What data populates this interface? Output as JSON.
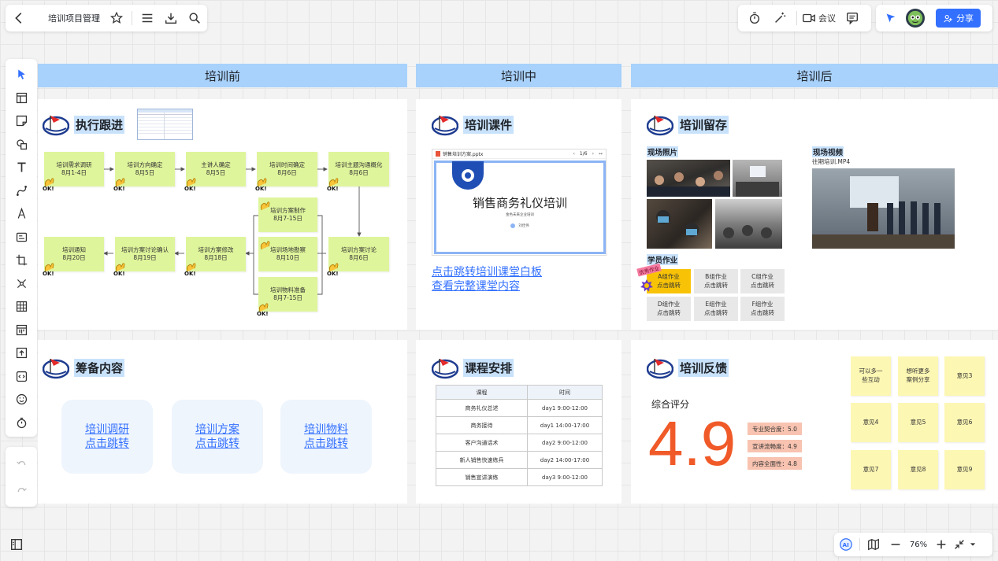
{
  "header": {
    "doc_title": "培训项目管理",
    "meeting_label": "会议",
    "share_label": "分享"
  },
  "zoom": {
    "level": "76%"
  },
  "sections": {
    "before": "培训前",
    "during": "培训中",
    "after": "培训后"
  },
  "execution": {
    "title": "执行跟进",
    "notes": [
      {
        "line1": "培训需求调研",
        "line2": "8月1-4日"
      },
      {
        "line1": "培训方向确定",
        "line2": "8月5日"
      },
      {
        "line1": "主讲人确定",
        "line2": "8月5日"
      },
      {
        "line1": "培训时间确定",
        "line2": "8月6日"
      },
      {
        "line1": "培训主题沟通概化",
        "line2": "8月6日"
      },
      {
        "line1": "培训方案制作",
        "line2": "8月7-15日"
      },
      {
        "line1": "培训场地勘察",
        "line2": "8月10日"
      },
      {
        "line1": "培训物料准备",
        "line2": "8月7-15日"
      },
      {
        "line1": "培训方案讨论",
        "line2": "8月6日"
      },
      {
        "line1": "培训方案修改",
        "line2": "8月18日"
      },
      {
        "line1": "培训方案讨论确认",
        "line2": "8月19日"
      },
      {
        "line1": "培训通知",
        "line2": "8月20日"
      }
    ]
  },
  "courseware": {
    "title": "培训课件",
    "file_name": "销售培训方案.pptx",
    "page": "1/6",
    "slide_title": "销售商务礼仪培训",
    "slide_sub": "金色未来企业培训",
    "slide_author": "刘佳伟",
    "link1": "点击跳转培训课堂白板",
    "link2": "查看完整课堂内容"
  },
  "retention": {
    "title": "培训留存",
    "photos_label": "现场照片",
    "video_label": "现场视频",
    "video_file": "往期培训.MP4",
    "homework_label": "学员作业",
    "excellent_tag": "优秀作业",
    "groups": [
      {
        "name": "A组作业",
        "action": "点击跳转"
      },
      {
        "name": "B组作业",
        "action": "点击跳转"
      },
      {
        "name": "C组作业",
        "action": "点击跳转"
      },
      {
        "name": "D组作业",
        "action": "点击跳转"
      },
      {
        "name": "E组作业",
        "action": "点击跳转"
      },
      {
        "name": "F组作业",
        "action": "点击跳转"
      }
    ]
  },
  "prep": {
    "title": "筹备内容",
    "cards": [
      {
        "line1": "培训调研",
        "line2": "点击跳转"
      },
      {
        "line1": "培训方案",
        "line2": "点击跳转"
      },
      {
        "line1": "培训物料",
        "line2": "点击跳转"
      }
    ]
  },
  "schedule": {
    "title": "课程安排",
    "headers": [
      "课程",
      "时间"
    ],
    "rows": [
      [
        "商务礼仪总述",
        "day1 9:00-12:00"
      ],
      [
        "商务接待",
        "day1 14:00-17:00"
      ],
      [
        "客户沟通话术",
        "day2 9:00-12:00"
      ],
      [
        "新人销售快速练兵",
        "day2 14:00-17:00"
      ],
      [
        "销售宣讲演练",
        "day3 9:00-12:00"
      ]
    ]
  },
  "feedback": {
    "title": "培训反馈",
    "score_label": "综合评分",
    "score": "4.9",
    "tags": [
      "专业契合度：5.0",
      "宣讲流畅度：4.9",
      "内容全面性：4.8"
    ],
    "notes": [
      {
        "line1": "可以多一",
        "line2": "些互动"
      },
      {
        "line1": "想听更多",
        "line2": "案例分享"
      },
      {
        "line1": "意见3",
        "line2": ""
      },
      {
        "line1": "意见4",
        "line2": ""
      },
      {
        "line1": "意见5",
        "line2": ""
      },
      {
        "line1": "意见6",
        "line2": ""
      },
      {
        "line1": "意见7",
        "line2": ""
      },
      {
        "line1": "意见8",
        "line2": ""
      },
      {
        "line1": "意见9",
        "line2": ""
      }
    ]
  },
  "colors": {
    "accent": "#3370ff",
    "section_header": "#a8d1fb",
    "sticky_green": "#dff59b",
    "sticky_yellow": "#fdf7b4",
    "score_red": "#f05a28"
  }
}
